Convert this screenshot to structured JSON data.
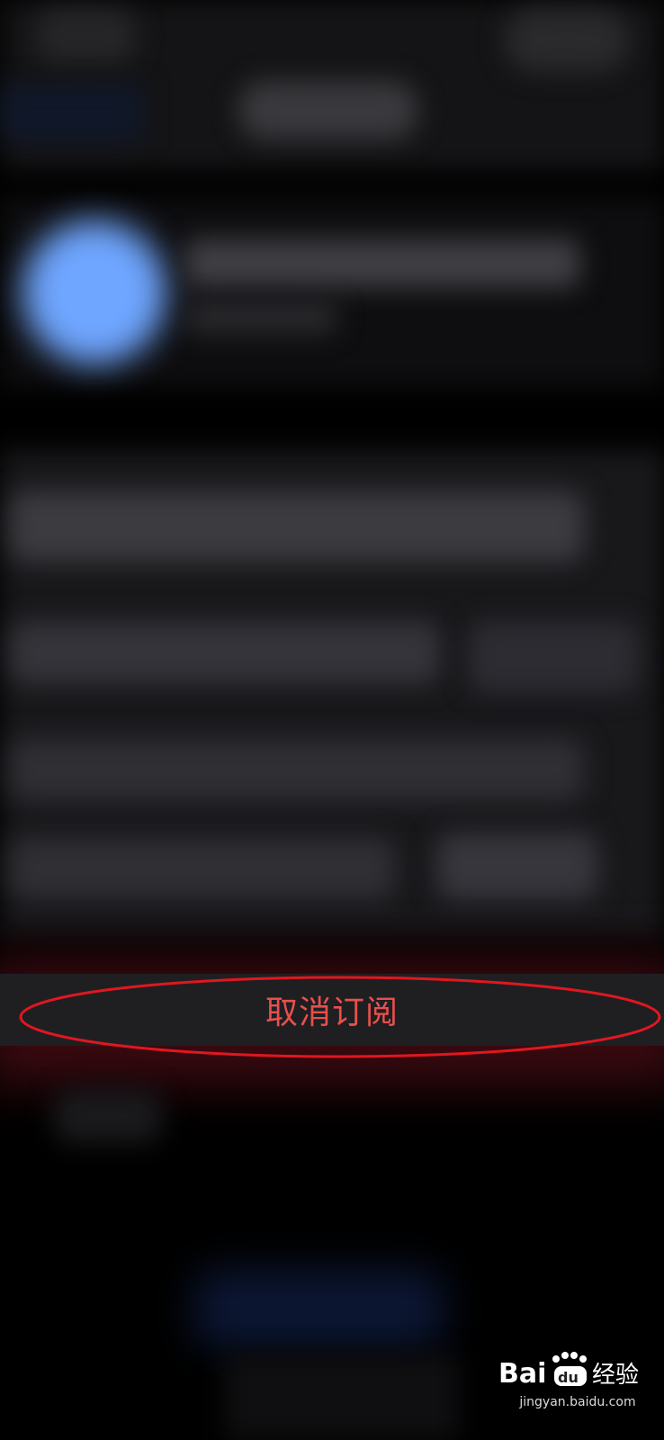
{
  "cancel_subscription": {
    "label": "取消订阅"
  },
  "watermark": {
    "brand": "Bai du 经验",
    "url": "jingyan.baidu.com"
  },
  "colors": {
    "cancel_text": "#e8504c",
    "highlight": "#e0171f",
    "background": "#000000"
  }
}
